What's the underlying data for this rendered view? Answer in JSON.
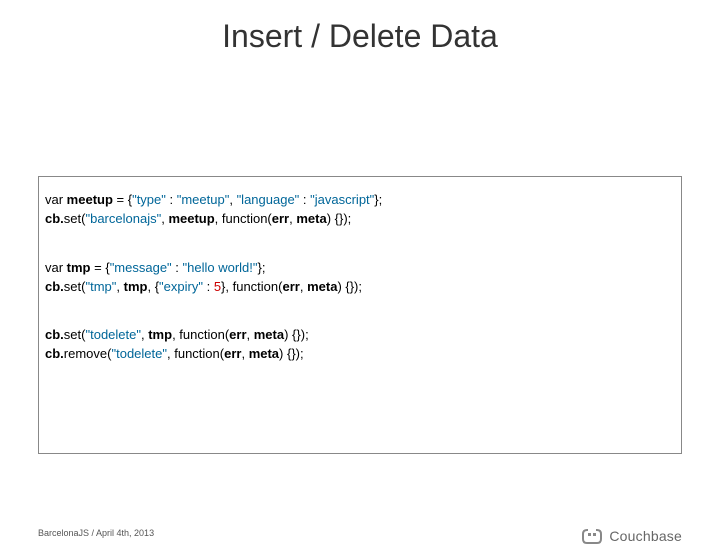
{
  "title": "Insert / Delete Data",
  "code": {
    "b1l1_a": "var ",
    "b1l1_b": "meetup",
    "b1l1_c": " = {",
    "b1l1_d": "\"type\"",
    "b1l1_e": " : ",
    "b1l1_f": "\"meetup\"",
    "b1l1_g": ", ",
    "b1l1_h": "\"language\"",
    "b1l1_i": " : ",
    "b1l1_j": "\"javascript\"",
    "b1l1_k": "};",
    "b1l2_a": "cb.",
    "b1l2_b": "set",
    "b1l2_c": "(",
    "b1l2_d": "\"barcelonajs\"",
    "b1l2_e": ", ",
    "b1l2_f": "meetup",
    "b1l2_g": ", function(",
    "b1l2_h": "err",
    "b1l2_i": ", ",
    "b1l2_j": "meta",
    "b1l2_k": ") {});",
    "b2l1_a": "var ",
    "b2l1_b": "tmp",
    "b2l1_c": " = {",
    "b2l1_d": "\"message\"",
    "b2l1_e": " : ",
    "b2l1_f": "\"hello world!\"",
    "b2l1_g": "};",
    "b2l2_a": "cb.",
    "b2l2_b": "set",
    "b2l2_c": "(",
    "b2l2_d": "\"tmp\"",
    "b2l2_e": ", ",
    "b2l2_f": "tmp",
    "b2l2_g": ", {",
    "b2l2_h": "\"expiry\"",
    "b2l2_i": " : ",
    "b2l2_j": "5",
    "b2l2_k": "}, function(",
    "b2l2_l": "err",
    "b2l2_m": ", ",
    "b2l2_n": "meta",
    "b2l2_o": ") {});",
    "b3l1_a": "cb.",
    "b3l1_b": "set",
    "b3l1_c": "(",
    "b3l1_d": "\"todelete\"",
    "b3l1_e": ", ",
    "b3l1_f": "tmp",
    "b3l1_g": ", function(",
    "b3l1_h": "err",
    "b3l1_i": ", ",
    "b3l1_j": "meta",
    "b3l1_k": ") {});",
    "b3l2_a": "cb.",
    "b3l2_b": "remove",
    "b3l2_c": "(",
    "b3l2_d": "\"todelete\"",
    "b3l2_e": ", function(",
    "b3l2_f": "err",
    "b3l2_g": ", ",
    "b3l2_h": "meta",
    "b3l2_i": ") {});"
  },
  "footer": {
    "left": "BarcelonaJS / April 4th, 2013",
    "brand": "Couchbase"
  }
}
